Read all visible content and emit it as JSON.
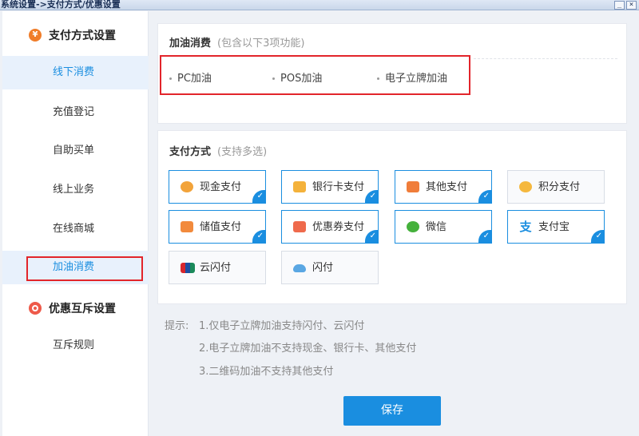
{
  "window": {
    "title": "系统设置->支付方式/优惠设置",
    "min_glyph": "_",
    "close_glyph": "×"
  },
  "sidebar": {
    "group_payment": "支付方式设置",
    "group_promo": "优惠互斥设置",
    "items": [
      {
        "label": "线下消费"
      },
      {
        "label": "充值登记"
      },
      {
        "label": "自助买单"
      },
      {
        "label": "线上业务"
      },
      {
        "label": "在线商城"
      },
      {
        "label": "加油消费"
      },
      {
        "label": "互斥规则"
      }
    ]
  },
  "fuel_card": {
    "title": "加油消费",
    "subtitle": "(包含以下3项功能)",
    "functions": [
      "PC加油",
      "POS加油",
      "电子立牌加油"
    ]
  },
  "payment_card": {
    "title": "支付方式",
    "subtitle": "(支持多选)",
    "check_glyph": "✓",
    "methods": [
      {
        "label": "现金支付",
        "icon": "cash-icon",
        "checked": true
      },
      {
        "label": "银行卡支付",
        "icon": "bank-card-icon",
        "checked": true
      },
      {
        "label": "其他支付",
        "icon": "other-pay-icon",
        "checked": true
      },
      {
        "label": "积分支付",
        "icon": "points-icon",
        "checked": false
      },
      {
        "label": "储值支付",
        "icon": "stored-value-icon",
        "checked": true
      },
      {
        "label": "优惠券支付",
        "icon": "coupon-icon",
        "checked": true
      },
      {
        "label": "微信",
        "icon": "wechat-icon",
        "checked": true
      },
      {
        "label": "支付宝",
        "icon": "alipay-icon",
        "checked": true,
        "glyph": "支"
      },
      {
        "label": "云闪付",
        "icon": "unionpay-icon",
        "checked": false
      },
      {
        "label": "闪付",
        "icon": "quickpass-icon",
        "checked": false
      }
    ]
  },
  "hints": {
    "prefix": "提示:",
    "lines": [
      "1.仅电子立牌加油支持闪付、云闪付",
      "2.电子立牌加油不支持现金、银行卡、其他支付",
      "3.二维码加油不支持其他支付"
    ]
  },
  "save_label": "保存",
  "colors": {
    "accent": "#1a8ee0",
    "highlight_border": "#e2252b",
    "selected_bg": "#e8f1fc"
  }
}
